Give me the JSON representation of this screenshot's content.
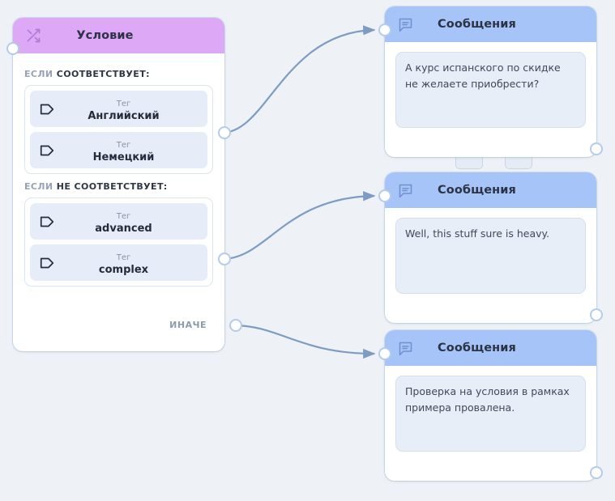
{
  "canvas": {
    "background_color": "#eef2f7",
    "edge_color": "#7d9cc4"
  },
  "condition_node": {
    "title": "Условие",
    "header_color": "#dda8f5",
    "icon": "shuffle-icon",
    "input_port": "input-port",
    "branches": [
      {
        "keyword": "ЕСЛИ",
        "condition": "СООТВЕТСТВУЕТ:",
        "output_port": "match-output-port",
        "tags": [
          {
            "kind": "Тег",
            "value": "Английский",
            "icon": "tag-icon"
          },
          {
            "kind": "Тег",
            "value": "Немецкий",
            "icon": "tag-icon"
          }
        ]
      },
      {
        "keyword": "ЕСЛИ",
        "condition": "НЕ СООТВЕТСТВУЕТ:",
        "output_port": "nomatch-output-port",
        "tags": [
          {
            "kind": "Тег",
            "value": "advanced",
            "icon": "tag-icon"
          },
          {
            "kind": "Тег",
            "value": "complex",
            "icon": "tag-icon"
          }
        ]
      }
    ],
    "else_label": "ИНАЧЕ",
    "else_output_port": "else-output-port"
  },
  "message_nodes": [
    {
      "title": "Сообщения",
      "header_color": "#a6c4f7",
      "icon": "message-bubble-icon",
      "text": "А курс испанского по скидке не желаете приобрести?"
    },
    {
      "title": "Сообщения",
      "header_color": "#a6c4f7",
      "icon": "message-bubble-icon",
      "text": "Well, this stuff sure is heavy."
    },
    {
      "title": "Сообщения",
      "header_color": "#a6c4f7",
      "icon": "message-bubble-icon",
      "text": "Проверка на условия в рамках примера провалена."
    }
  ]
}
